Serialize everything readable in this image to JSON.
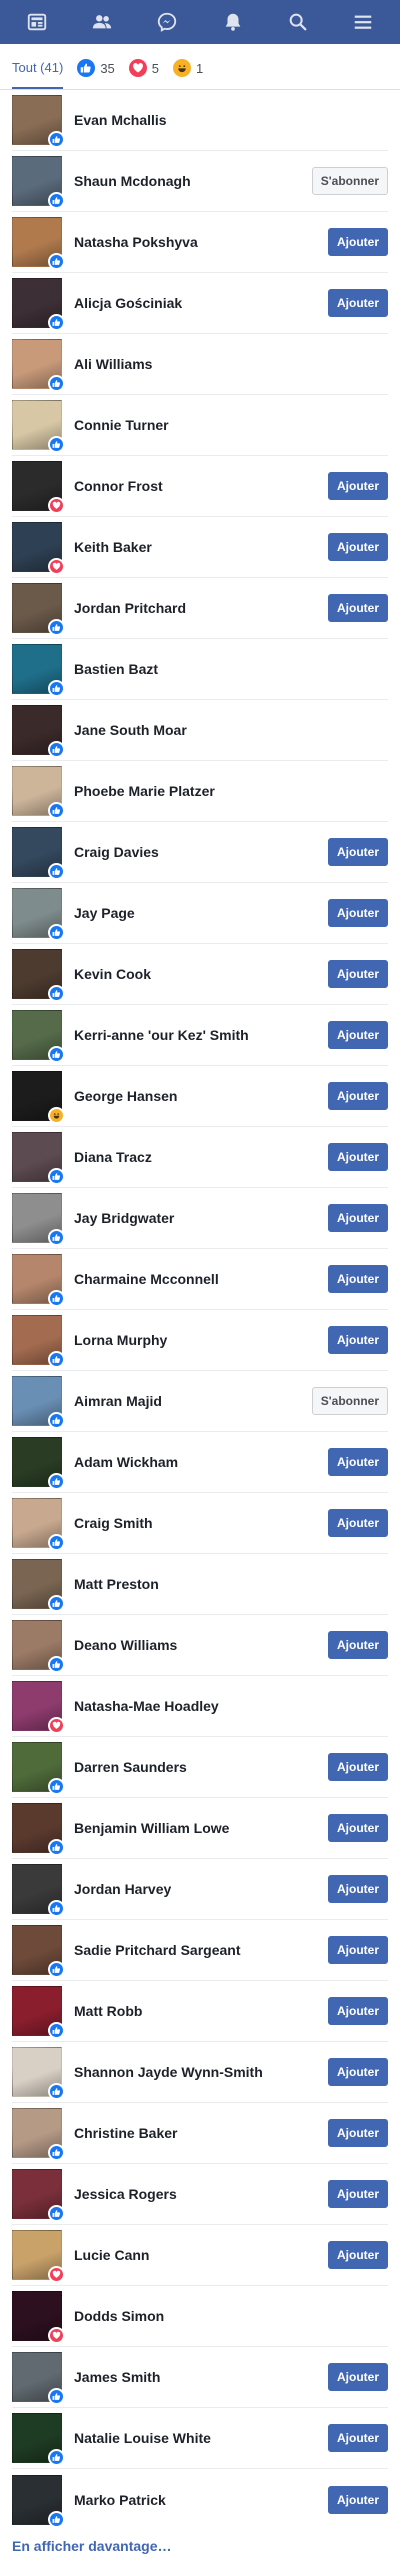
{
  "colors": {
    "brand": "#3b5998",
    "accent": "#4267b2",
    "like": "#1877f2",
    "love": "#f33e58",
    "haha": "#f7b125"
  },
  "nav": [
    {
      "name": "news-feed-icon"
    },
    {
      "name": "friends-icon"
    },
    {
      "name": "messenger-icon"
    },
    {
      "name": "notifications-icon"
    },
    {
      "name": "search-icon"
    },
    {
      "name": "menu-icon"
    }
  ],
  "tabs": {
    "all_label": "Tout (41)",
    "like_count": "35",
    "love_count": "5",
    "haha_count": "1"
  },
  "people": [
    {
      "name": "Evan Mchallis",
      "reaction": "like",
      "action": "",
      "avatar_color": "#8a6d55"
    },
    {
      "name": "Shaun Mcdonagh",
      "reaction": "like",
      "action": "S'abonner",
      "avatar_color": "#5a6b7c"
    },
    {
      "name": "Natasha Pokshyva",
      "reaction": "like",
      "action": "Ajouter",
      "avatar_color": "#b07a4d"
    },
    {
      "name": "Alicja Gościniak",
      "reaction": "like",
      "action": "Ajouter",
      "avatar_color": "#3d2f36"
    },
    {
      "name": "Ali Williams",
      "reaction": "like",
      "action": "",
      "avatar_color": "#c89a7a"
    },
    {
      "name": "Connie Turner",
      "reaction": "like",
      "action": "",
      "avatar_color": "#d7c7a5"
    },
    {
      "name": "Connor Frost",
      "reaction": "love",
      "action": "Ajouter",
      "avatar_color": "#2b2b2b"
    },
    {
      "name": "Keith Baker",
      "reaction": "love",
      "action": "Ajouter",
      "avatar_color": "#2e4053"
    },
    {
      "name": "Jordan Pritchard",
      "reaction": "like",
      "action": "Ajouter",
      "avatar_color": "#6b5a4a"
    },
    {
      "name": "Bastien Bazt",
      "reaction": "like",
      "action": "",
      "avatar_color": "#1f6f8b"
    },
    {
      "name": "Jane South Moar",
      "reaction": "like",
      "action": "",
      "avatar_color": "#3b2a2a"
    },
    {
      "name": "Phoebe Marie Platzer",
      "reaction": "like",
      "action": "",
      "avatar_color": "#cdb59a"
    },
    {
      "name": "Craig Davies",
      "reaction": "like",
      "action": "Ajouter",
      "avatar_color": "#34495e"
    },
    {
      "name": "Jay Page",
      "reaction": "like",
      "action": "Ajouter",
      "avatar_color": "#7f8c8d"
    },
    {
      "name": "Kevin Cook",
      "reaction": "like",
      "action": "Ajouter",
      "avatar_color": "#4d3b2f"
    },
    {
      "name": "Kerri-anne 'our Kez' Smith",
      "reaction": "like",
      "action": "Ajouter",
      "avatar_color": "#556b4a"
    },
    {
      "name": "George Hansen",
      "reaction": "haha",
      "action": "Ajouter",
      "avatar_color": "#1c1c1c"
    },
    {
      "name": "Diana Tracz",
      "reaction": "like",
      "action": "Ajouter",
      "avatar_color": "#5d4b52"
    },
    {
      "name": "Jay Bridgwater",
      "reaction": "like",
      "action": "Ajouter",
      "avatar_color": "#8e8e8e"
    },
    {
      "name": "Charmaine Mcconnell",
      "reaction": "like",
      "action": "Ajouter",
      "avatar_color": "#b5866b"
    },
    {
      "name": "Lorna Murphy",
      "reaction": "like",
      "action": "Ajouter",
      "avatar_color": "#a36b4f"
    },
    {
      "name": "Aimran Majid",
      "reaction": "like",
      "action": "S'abonner",
      "avatar_color": "#6a8fb5"
    },
    {
      "name": "Adam Wickham",
      "reaction": "like",
      "action": "Ajouter",
      "avatar_color": "#2a3d24"
    },
    {
      "name": "Craig Smith",
      "reaction": "like",
      "action": "Ajouter",
      "avatar_color": "#c8a98f"
    },
    {
      "name": "Matt Preston",
      "reaction": "like",
      "action": "",
      "avatar_color": "#7a6552"
    },
    {
      "name": "Deano Williams",
      "reaction": "like",
      "action": "Ajouter",
      "avatar_color": "#9b7a66"
    },
    {
      "name": "Natasha-Mae Hoadley",
      "reaction": "love",
      "action": "",
      "avatar_color": "#8e3b6e"
    },
    {
      "name": "Darren Saunders",
      "reaction": "like",
      "action": "Ajouter",
      "avatar_color": "#4f6b3a"
    },
    {
      "name": "Benjamin William Lowe",
      "reaction": "like",
      "action": "Ajouter",
      "avatar_color": "#5b3a2e"
    },
    {
      "name": "Jordan Harvey",
      "reaction": "like",
      "action": "Ajouter",
      "avatar_color": "#3a3a3a"
    },
    {
      "name": "Sadie Pritchard Sargeant",
      "reaction": "like",
      "action": "Ajouter",
      "avatar_color": "#6e4a3a"
    },
    {
      "name": "Matt Robb",
      "reaction": "like",
      "action": "Ajouter",
      "avatar_color": "#8b1e2d"
    },
    {
      "name": "Shannon Jayde Wynn-Smith",
      "reaction": "like",
      "action": "Ajouter",
      "avatar_color": "#d9d0c5"
    },
    {
      "name": "Christine Baker",
      "reaction": "like",
      "action": "Ajouter",
      "avatar_color": "#b59a86"
    },
    {
      "name": "Jessica Rogers",
      "reaction": "like",
      "action": "Ajouter",
      "avatar_color": "#7a2f3a"
    },
    {
      "name": "Lucie Cann",
      "reaction": "love",
      "action": "Ajouter",
      "avatar_color": "#c9a26a"
    },
    {
      "name": "Dodds Simon",
      "reaction": "love",
      "action": "",
      "avatar_color": "#2d1020"
    },
    {
      "name": "James Smith",
      "reaction": "like",
      "action": "Ajouter",
      "avatar_color": "#606a70"
    },
    {
      "name": "Natalie Louise White",
      "reaction": "like",
      "action": "Ajouter",
      "avatar_color": "#1e3b24"
    },
    {
      "name": "Marko Patrick",
      "reaction": "like",
      "action": "Ajouter",
      "avatar_color": "#2a2f33"
    }
  ],
  "more_label": "En afficher davantage…"
}
